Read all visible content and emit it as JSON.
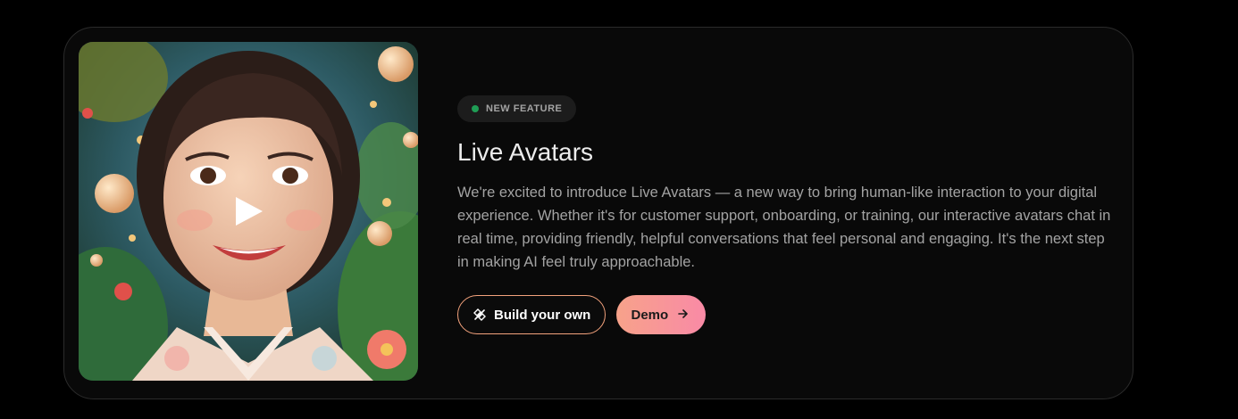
{
  "feature": {
    "badge_label": "NEW FEATURE",
    "badge_dot_color": "#1f9d55",
    "title": "Live Avatars",
    "description": "We're excited to introduce Live Avatars — a new way to bring human-like interaction to your digital experience. Whether it's for customer support, onboarding, or training, our interactive avatars chat in real time, providing friendly, helpful conversations that feel personal and engaging. It's the next step in making AI feel truly approachable.",
    "media": {
      "image_subject": "illustrated smiling woman avatar",
      "play_icon": "play-icon"
    },
    "actions": {
      "build_label": "Build your own",
      "build_icon": "tools-icon",
      "demo_label": "Demo",
      "demo_icon": "arrow-right-icon"
    }
  },
  "colors": {
    "background": "#000000",
    "card": "#090909",
    "card_border": "#2b2b2b",
    "accent_border": "#f3a27c",
    "demo_gradient_start": "#f7a28a",
    "demo_gradient_end": "#f98aa6"
  }
}
